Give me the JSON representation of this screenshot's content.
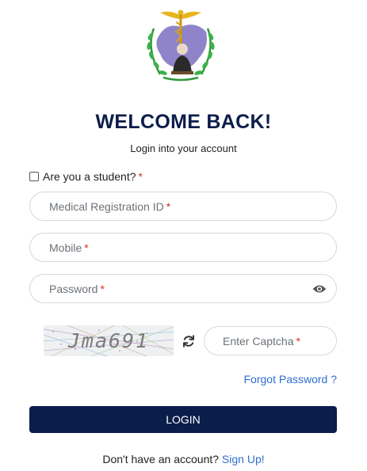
{
  "header": {
    "title": "WELCOME BACK!",
    "subtitle": "Login into your account"
  },
  "student": {
    "label": "Are you a student?",
    "required_mark": "*",
    "checked": false
  },
  "fields": {
    "registration": {
      "placeholder": "Medical Registration ID",
      "required_mark": "*",
      "value": ""
    },
    "mobile": {
      "placeholder": "Mobile",
      "required_mark": "*",
      "value": ""
    },
    "password": {
      "placeholder": "Password",
      "required_mark": "*",
      "value": ""
    },
    "captcha": {
      "placeholder": "Enter Captcha",
      "required_mark": "*",
      "value": ""
    }
  },
  "captcha_image": {
    "text": "Jma691"
  },
  "links": {
    "forgot_password": "Forgot Password ?",
    "no_account": "Don't have an account?",
    "sign_up": "Sign Up!"
  },
  "buttons": {
    "login": "LOGIN"
  },
  "icons": {
    "logo": "caduceus-map-emblem",
    "password_toggle": "eye-icon",
    "captcha_refresh": "refresh-icon"
  },
  "colors": {
    "primary": "#0b1d4b",
    "link": "#2f6fd1",
    "required": "#d9302a",
    "border": "#d5d8dc"
  }
}
